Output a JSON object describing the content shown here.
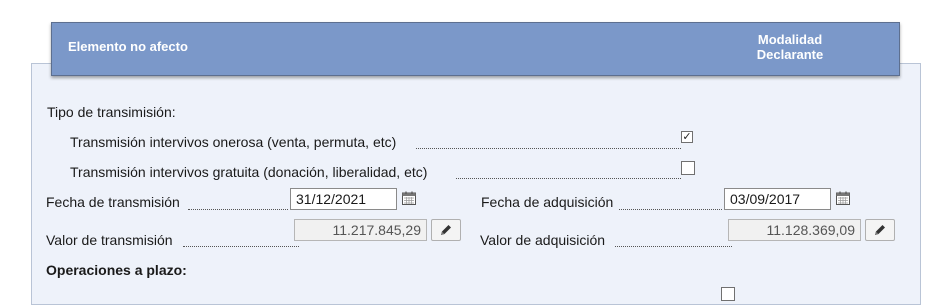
{
  "header": {
    "title": "Elemento no afecto",
    "column_line1": "Modalidad",
    "column_line2": "Declarante"
  },
  "form": {
    "tipo_label": "Tipo de transimisión:",
    "onerosa_label": "Transmisión intervivos onerosa (venta, permuta, etc)",
    "onerosa_checked": true,
    "gratuita_label": "Transmisión intervivos gratuita (donación, liberalidad, etc)",
    "gratuita_checked": false,
    "fecha_transmision_label": "Fecha de transmisión",
    "fecha_transmision_value": "31/12/2021",
    "fecha_adquisicion_label": "Fecha de adquisición",
    "fecha_adquisicion_value": "03/09/2017",
    "valor_transmision_label": "Valor de transmisión",
    "valor_transmision_value": "11.217.845,29",
    "valor_adquisicion_label": "Valor de adquisición",
    "valor_adquisicion_value": "11.128.369,09",
    "operaciones_label": "Operaciones a plazo:",
    "check_mark": "✓",
    "icons": {
      "date": "calendar-icon",
      "edit": "pencil-icon"
    }
  }
}
